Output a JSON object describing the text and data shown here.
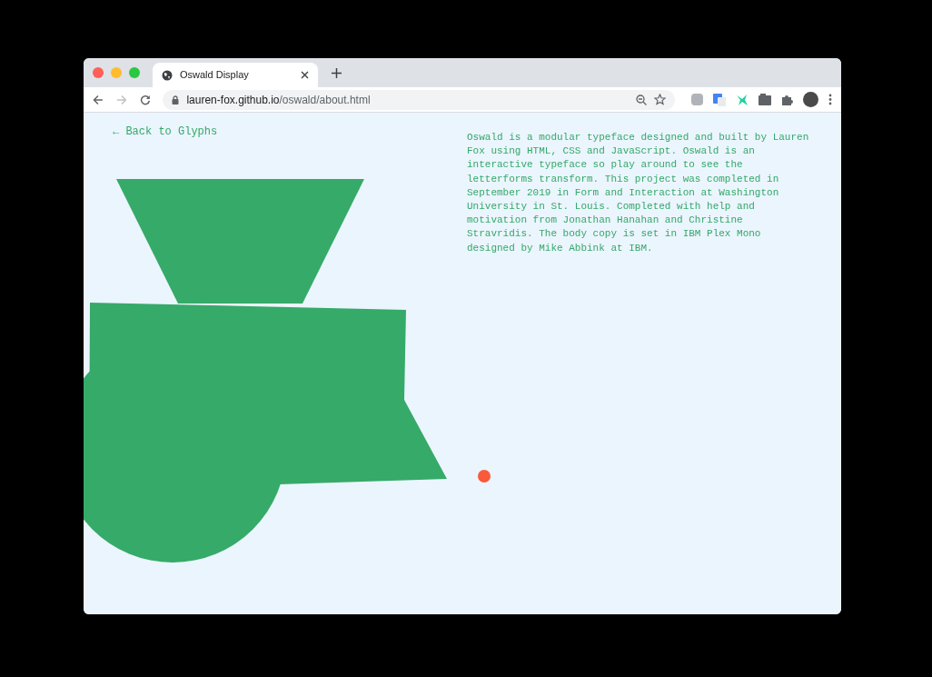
{
  "browser": {
    "tab": {
      "title": "Oswald Display",
      "selected": true
    },
    "address": {
      "host": "lauren-fox.github.io",
      "path": "/oswald/about.html"
    }
  },
  "page": {
    "back_link": "← Back to Glyphs",
    "about": "Oswald is a modular typeface designed and built by Lauren Fox using HTML, CSS and JavaScript. Oswald is an interactive typeface so play around to see the letterforms transform. This project was completed in September 2019 in Form and Interaction at Washington University in St. Louis. Completed with help and motivation from Jonathan Hanahan and Christine Stravridis. The body copy is set in IBM Plex Mono designed by Mike Abbink at IBM."
  }
}
